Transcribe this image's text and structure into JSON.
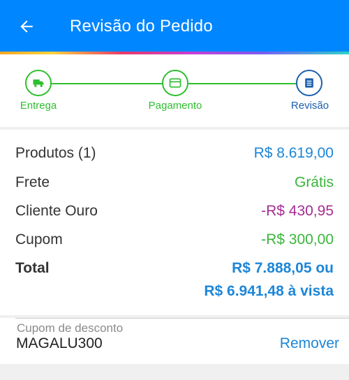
{
  "appbar": {
    "title": "Revisão do Pedido"
  },
  "steps": [
    {
      "label": "Entrega",
      "icon": "truck-icon",
      "state": "done"
    },
    {
      "label": "Pagamento",
      "icon": "credit-card-icon",
      "state": "done"
    },
    {
      "label": "Revisão",
      "icon": "list-icon",
      "state": "active"
    }
  ],
  "summary": {
    "products_label": "Produtos (1)",
    "products_value": "R$ 8.619,00",
    "shipping_label": "Frete",
    "shipping_value": "Grátis",
    "gold_label": "Cliente Ouro",
    "gold_value": "-R$ 430,95",
    "coupon_label": "Cupom",
    "coupon_value": "-R$ 300,00",
    "total_label": "Total",
    "total_value": "R$ 7.888,05 ou",
    "total_cash_value": "R$ 6.941,48 à vista"
  },
  "coupon": {
    "caption": "Cupom de desconto",
    "code": "MAGALU300",
    "remove_label": "Remover"
  },
  "colors": {
    "appbar": "#0086ff",
    "step_done": "#2fbf2f",
    "step_active": "#1b5fae",
    "blue_value": "#1d86d8",
    "green_value": "#3bb43b",
    "purple_value": "#a52d92"
  }
}
